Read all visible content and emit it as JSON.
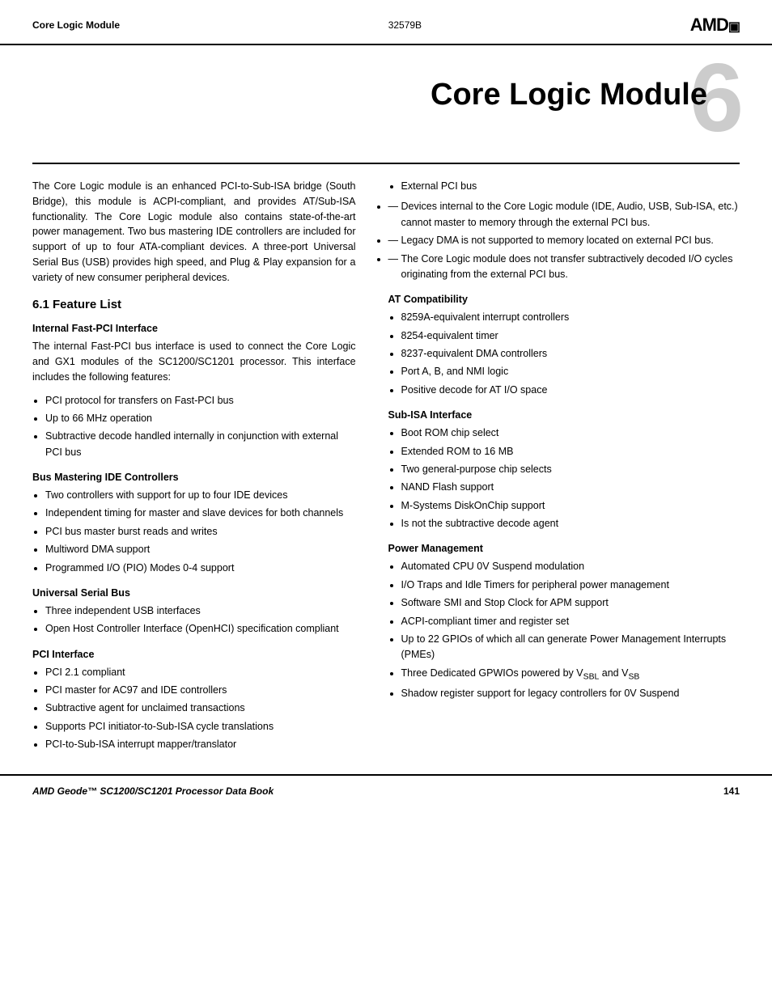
{
  "header": {
    "left": "Core Logic Module",
    "center": "32579B",
    "logo": "AMD▣"
  },
  "chapter": {
    "number": "6",
    "title": "Core Logic Module"
  },
  "intro": "The Core Logic module is an enhanced PCI-to-Sub-ISA bridge (South Bridge), this module is ACPI-compliant, and provides AT/Sub-ISA functionality. The Core Logic module also contains state-of-the-art power management. Two bus mastering IDE controllers are included for support of up to four ATA-compliant devices. A three-port Universal Serial Bus (USB) provides high speed, and Plug & Play expansion for a variety of new consumer peripheral devices.",
  "section61": {
    "title": "6.1  Feature List"
  },
  "left_col": {
    "internal_fast_pci": {
      "title": "Internal Fast-PCI Interface",
      "intro": "The internal Fast-PCI bus interface is used to connect the Core Logic and GX1 modules of the SC1200/SC1201 processor. This interface includes the following features:",
      "bullets": [
        "PCI protocol for transfers on Fast-PCI bus",
        "Up to 66 MHz operation",
        "Subtractive decode handled internally in conjunction with external PCI bus"
      ]
    },
    "bus_mastering": {
      "title": "Bus Mastering IDE Controllers",
      "bullets": [
        "Two controllers with support for up to four IDE devices",
        "Independent timing for master and slave devices for both channels",
        "PCI bus master burst reads and writes",
        "Multiword DMA support",
        "Programmed I/O (PIO) Modes 0-4 support"
      ]
    },
    "usb": {
      "title": "Universal Serial Bus",
      "bullets": [
        "Three independent USB interfaces",
        "Open Host Controller Interface (OpenHCI) specification compliant"
      ]
    },
    "pci": {
      "title": "PCI Interface",
      "bullets": [
        "PCI 2.1 compliant",
        "PCI master for AC97 and IDE controllers",
        "Subtractive agent for unclaimed transactions",
        "Supports PCI initiator-to-Sub-ISA cycle translations",
        "PCI-to-Sub-ISA interrupt mapper/translator"
      ]
    }
  },
  "right_col": {
    "external_pci": {
      "label": "External PCI bus",
      "sub_bullets": [
        "Devices internal to the Core Logic module (IDE, Audio, USB, Sub-ISA, etc.) cannot master to memory through the external PCI bus.",
        "Legacy DMA is not supported to memory located on external PCI bus.",
        "The Core Logic module does not transfer subtractively decoded I/O cycles originating from the external PCI bus."
      ]
    },
    "at_compat": {
      "title": "AT Compatibility",
      "bullets": [
        "8259A-equivalent interrupt controllers",
        "8254-equivalent timer",
        "8237-equivalent DMA controllers",
        "Port A, B, and NMI logic",
        "Positive decode for AT I/O space"
      ]
    },
    "sub_isa": {
      "title": "Sub-ISA Interface",
      "bullets": [
        "Boot ROM chip select",
        "Extended ROM to 16 MB",
        "Two general-purpose chip selects",
        "NAND Flash support",
        "M-Systems DiskOnChip support",
        "Is not the subtractive decode agent"
      ]
    },
    "power_mgmt": {
      "title": "Power Management",
      "bullets": [
        "Automated CPU 0V Suspend modulation",
        "I/O Traps and Idle Timers for peripheral power management",
        "Software SMI and Stop Clock for APM support",
        "ACPI-compliant timer and register set",
        "Up to 22 GPIOs of which all can generate Power Management Interrupts (PMEs)",
        "Three Dedicated GPWIOs powered by V",
        "Shadow register support for legacy controllers for 0V Suspend"
      ],
      "vsbl_label": "SBL",
      "vsb_label": "SB",
      "vsbl_text": "V",
      "and_text": " and ",
      "vsb_text": "V",
      "gpwios_full": "Three Dedicated GPWIOs powered by Vₛⱼⱼ and Vₛⱼ"
    }
  },
  "footer": {
    "left": "AMD Geode™ SC1200/SC1201 Processor Data Book",
    "right": "141"
  }
}
